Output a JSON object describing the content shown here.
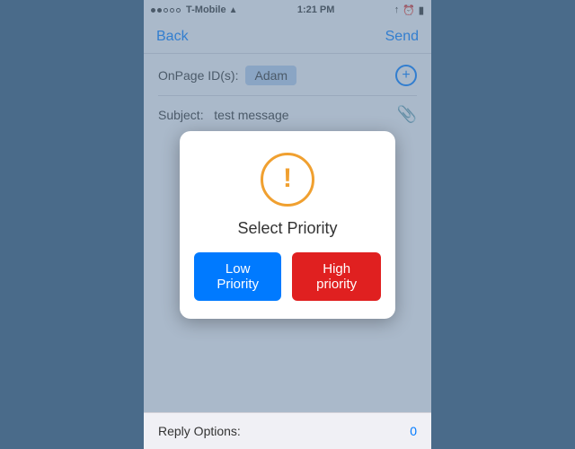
{
  "statusBar": {
    "carrier": "T-Mobile",
    "time": "1:21 PM",
    "signal": "●●○○○"
  },
  "navBar": {
    "back": "Back",
    "send": "Send"
  },
  "form": {
    "onpageLabel": "OnPage ID(s):",
    "onpageValue": "Adam",
    "addButtonLabel": "+",
    "subjectLabel": "Subject:",
    "subjectValue": "test message",
    "replyLabel": "Reply Options:",
    "replyValue": "0"
  },
  "dialog": {
    "title": "Select Priority",
    "iconSymbol": "!",
    "lowPriorityLabel": "Low Priority",
    "highPriorityLabel": "High priority"
  }
}
